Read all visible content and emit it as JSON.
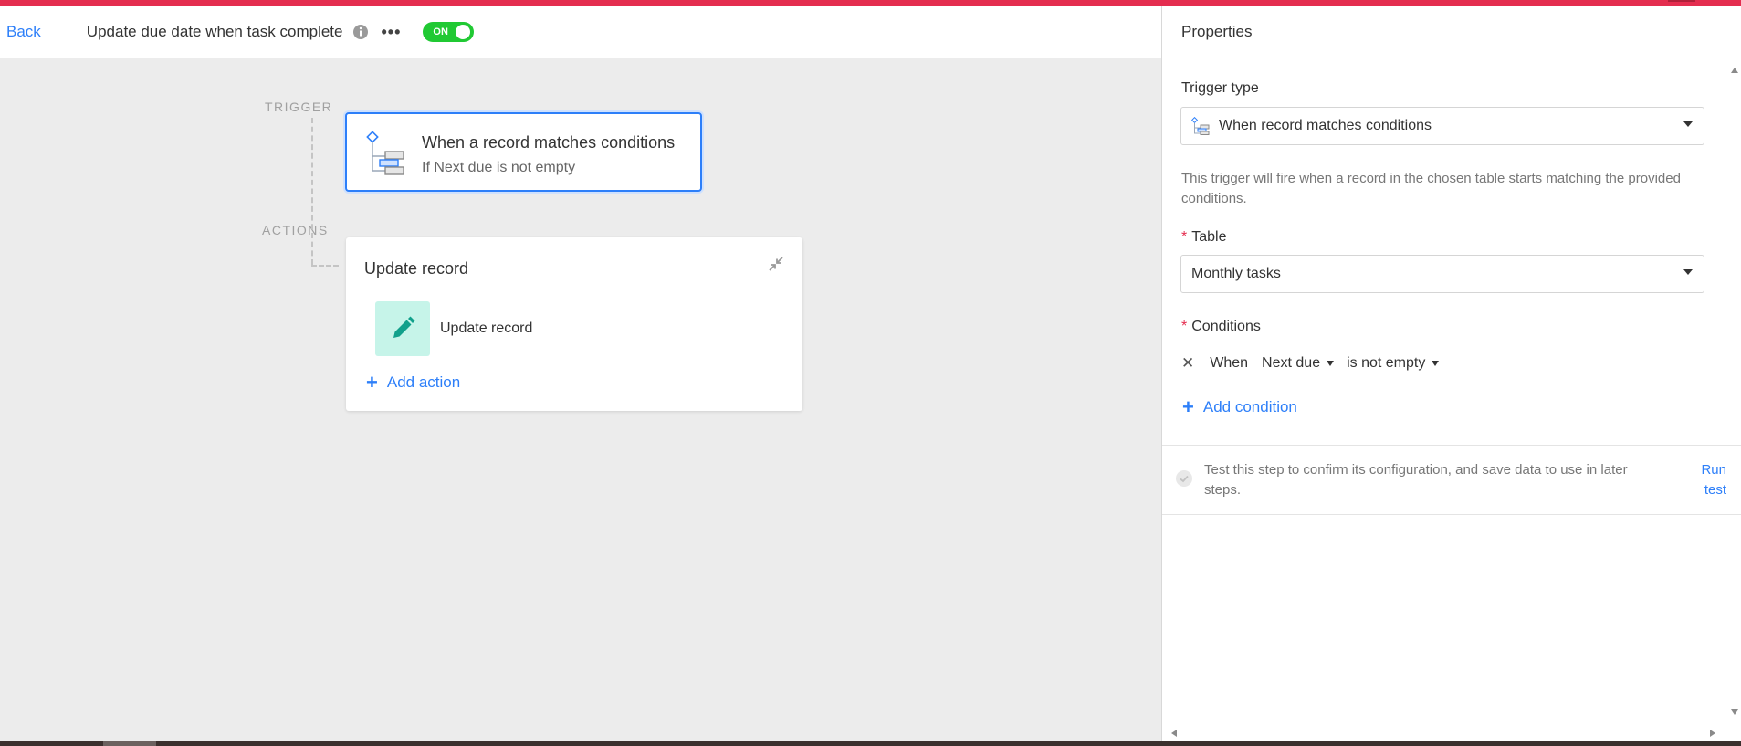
{
  "header": {
    "back_label": "Back",
    "title": "Update due date when task complete",
    "toggle_label": "ON"
  },
  "canvas": {
    "trigger_label": "TRIGGER",
    "actions_label": "ACTIONS",
    "trigger_card": {
      "title": "When a record matches conditions",
      "subtitle": "If Next due is not empty"
    },
    "action_card": {
      "title": "Update record",
      "item_label": "Update record",
      "add_action_label": "Add action"
    }
  },
  "panel": {
    "title": "Properties",
    "trigger_type_label": "Trigger type",
    "trigger_type_value": "When record matches conditions",
    "description": "This trigger will fire when a record in the chosen table starts matching the provided conditions.",
    "table_label": "Table",
    "table_value": "Monthly tasks",
    "conditions_label": "Conditions",
    "condition": {
      "when": "When",
      "field": "Next due",
      "operator": "is not empty"
    },
    "add_condition_label": "Add condition",
    "test_text": "Test this step to confirm its configuration, and save data to use in later steps.",
    "run_test_label": "Run test"
  },
  "colors": {
    "accent_blue": "#2d7ff9",
    "toggle_green": "#20c933",
    "top_stripe": "#e42d4f",
    "action_icon_bg": "#c6f4e9",
    "action_icon_fg": "#11a08b"
  },
  "icons": {
    "info": "info-icon",
    "more": "more-icon",
    "trigger": "conditions-tree-icon",
    "collapse": "collapse-icon",
    "action": "pencil-icon",
    "remove_condition": "close-icon",
    "test_status": "check-circle-icon"
  }
}
